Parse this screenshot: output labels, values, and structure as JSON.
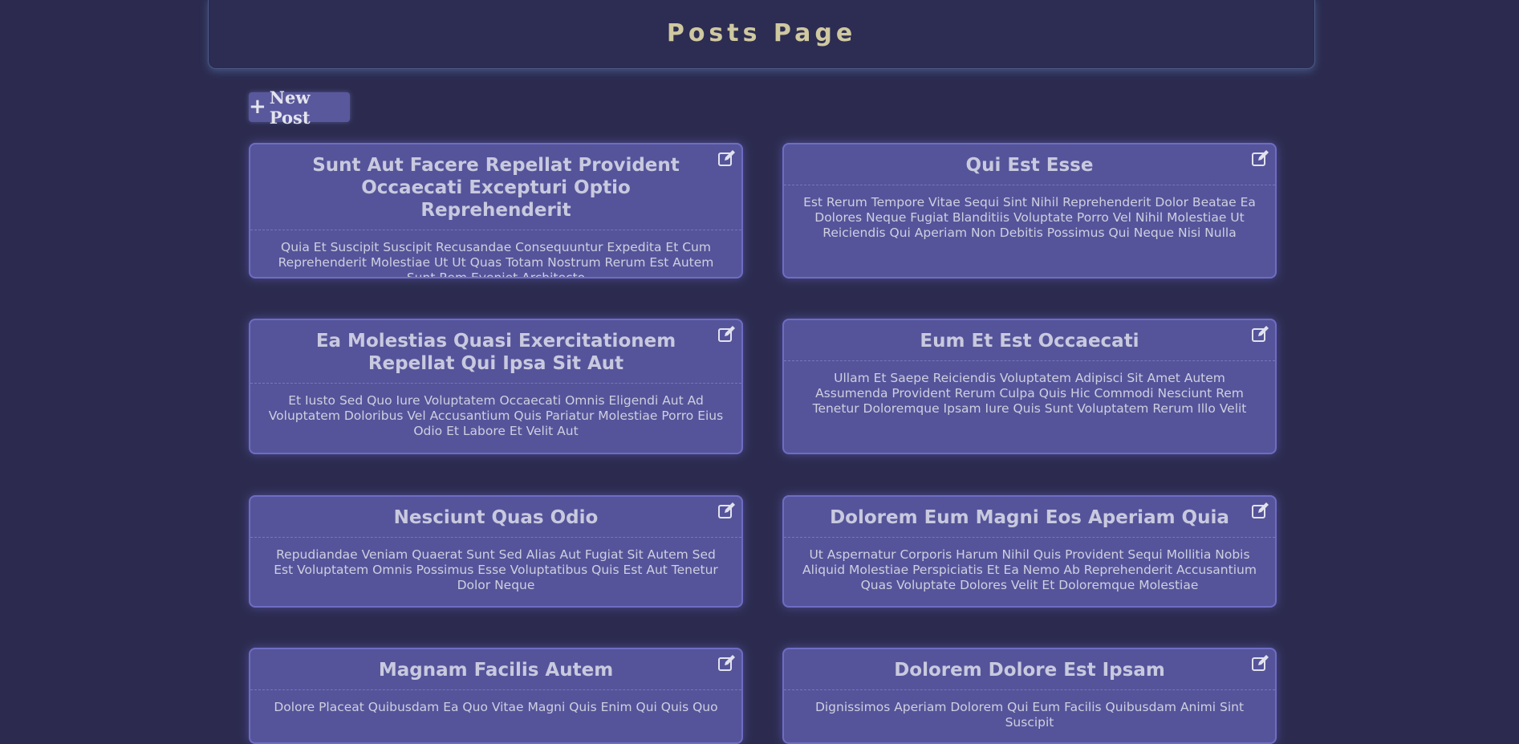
{
  "header": {
    "title": "Posts Page"
  },
  "new_post_button": {
    "icon": "plus-icon",
    "label": "New Post"
  },
  "posts": [
    {
      "title": "Sunt Aut Facere Repellat Provident Occaecati Excepturi Optio Reprehenderit",
      "body": "Quia Et Suscipit Suscipit Recusandae Consequuntur Expedita Et Cum Reprehenderit Molestiae Ut Ut Quas Totam Nostrum Rerum Est Autem Sunt Rem Eveniet Architecto",
      "icon": "edit-icon"
    },
    {
      "title": "Qui Est Esse",
      "body": "Est Rerum Tempore Vitae Sequi Sint Nihil Reprehenderit Dolor Beatae Ea Dolores Neque Fugiat Blanditiis Voluptate Porro Vel Nihil Molestiae Ut Reiciendis Qui Aperiam Non Debitis Possimus Qui Neque Nisi Nulla",
      "icon": "edit-icon"
    },
    {
      "title": "Ea Molestias Quasi Exercitationem Repellat Qui Ipsa Sit Aut",
      "body": "Et Iusto Sed Quo Iure Voluptatem Occaecati Omnis Eligendi Aut Ad Voluptatem Doloribus Vel Accusantium Quis Pariatur Molestiae Porro Eius Odio Et Labore Et Velit Aut",
      "icon": "edit-icon"
    },
    {
      "title": "Eum Et Est Occaecati",
      "body": "Ullam Et Saepe Reiciendis Voluptatem Adipisci Sit Amet Autem Assumenda Provident Rerum Culpa Quis Hic Commodi Nesciunt Rem Tenetur Doloremque Ipsam Iure Quis Sunt Voluptatem Rerum Illo Velit",
      "icon": "edit-icon"
    },
    {
      "title": "Nesciunt Quas Odio",
      "body": "Repudiandae Veniam Quaerat Sunt Sed Alias Aut Fugiat Sit Autem Sed Est Voluptatem Omnis Possimus Esse Voluptatibus Quis Est Aut Tenetur Dolor Neque",
      "icon": "edit-icon"
    },
    {
      "title": "Dolorem Eum Magni Eos Aperiam Quia",
      "body": "Ut Aspernatur Corporis Harum Nihil Quis Provident Sequi Mollitia Nobis Aliquid Molestiae Perspiciatis Et Ea Nemo Ab Reprehenderit Accusantium Quas Voluptate Dolores Velit Et Doloremque Molestiae",
      "icon": "edit-icon"
    },
    {
      "title": "Magnam Facilis Autem",
      "body": "Dolore Placeat Quibusdam Ea Quo Vitae Magni Quis Enim Qui Quis Quo",
      "icon": "edit-icon"
    },
    {
      "title": "Dolorem Dolore Est Ipsam",
      "body": "Dignissimos Aperiam Dolorem Qui Eum Facilis Quibusdam Animi Sint Suscipit",
      "icon": "edit-icon"
    }
  ],
  "colors": {
    "background": "#2c2b4f",
    "card": "#55549a",
    "title_text": "#cfc8a0"
  }
}
